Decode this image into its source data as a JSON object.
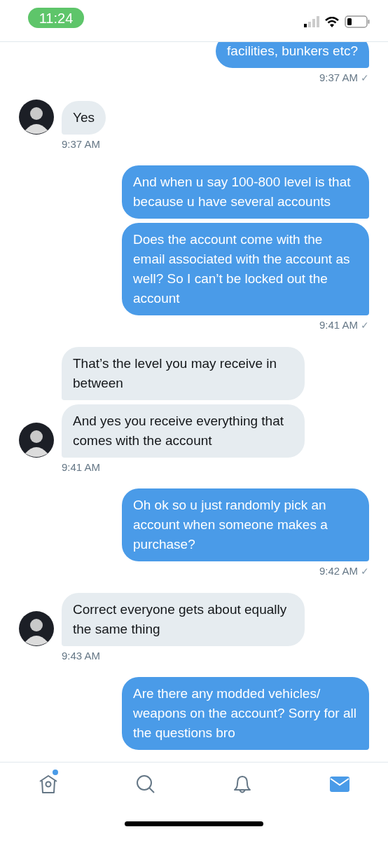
{
  "status_bar": {
    "time": "11:24"
  },
  "messages": [
    {
      "kind": "outgoing",
      "bubbles": [
        "facilities, bunkers etc?"
      ],
      "time": "9:37 AM",
      "receipt": "✓"
    },
    {
      "kind": "incoming",
      "bubbles": [
        "Yes"
      ],
      "time": "9:37 AM"
    },
    {
      "kind": "outgoing",
      "bubbles": [
        "And when u say 100-800 level is that because u have several accounts",
        "Does the account come with the email associated with the account as well? So I can’t be locked out the account"
      ],
      "time": "9:41 AM",
      "receipt": "✓"
    },
    {
      "kind": "incoming",
      "bubbles": [
        "That’s the level you may receive in between",
        "And yes you receive everything that comes with the account"
      ],
      "time": "9:41 AM"
    },
    {
      "kind": "outgoing",
      "bubbles": [
        "Oh ok so u just randomly pick an account when someone makes a purchase?"
      ],
      "time": "9:42 AM",
      "receipt": "✓"
    },
    {
      "kind": "incoming",
      "bubbles": [
        "Correct everyone gets about equally the same thing"
      ],
      "time": "9:43 AM"
    },
    {
      "kind": "outgoing",
      "bubbles": [
        "Are there any modded vehicles/ weapons on the account? Sorry for all the questions bro"
      ]
    }
  ],
  "tab_bar": [
    {
      "kind": "home",
      "selected": false,
      "badge": true
    },
    {
      "kind": "search",
      "selected": false,
      "badge": false
    },
    {
      "kind": "notifications",
      "selected": false,
      "badge": false
    },
    {
      "kind": "messages",
      "selected": true,
      "badge": false
    }
  ]
}
